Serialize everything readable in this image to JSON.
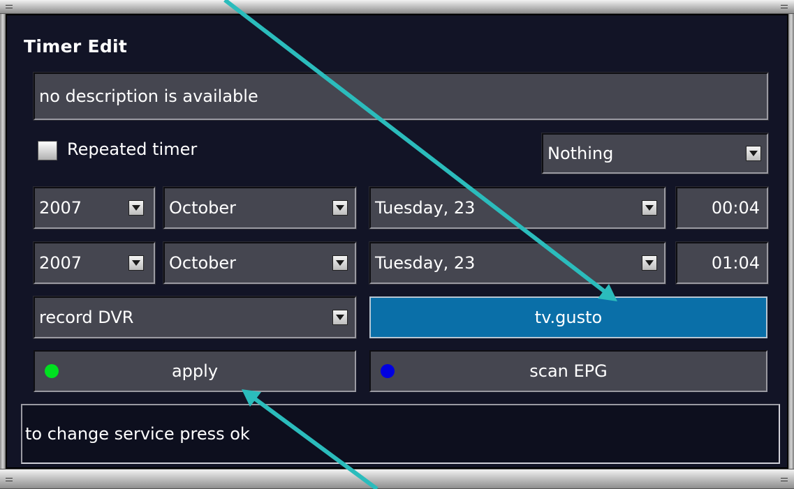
{
  "window": {
    "title": "Timer Edit"
  },
  "description": {
    "value": "no description is available"
  },
  "repeat": {
    "label": "Repeated timer",
    "checked": false
  },
  "after_event": {
    "value": "Nothing"
  },
  "start": {
    "year": "2007",
    "month": "October",
    "day": "Tuesday, 23",
    "time": "00:04"
  },
  "end": {
    "year": "2007",
    "month": "October",
    "day": "Tuesday, 23",
    "time": "01:04"
  },
  "action": {
    "value": "record DVR"
  },
  "service": {
    "value": "tv.gusto"
  },
  "buttons": {
    "apply": {
      "label": "apply",
      "dot_color": "#00e020"
    },
    "scan": {
      "label": "scan EPG",
      "dot_color": "#0000e0"
    }
  },
  "status": {
    "text": "to change service press ok"
  },
  "colors": {
    "panel": "#121426",
    "field": "#454650",
    "selected": "#0a6fa8",
    "arrow": "#2bbcbc"
  }
}
